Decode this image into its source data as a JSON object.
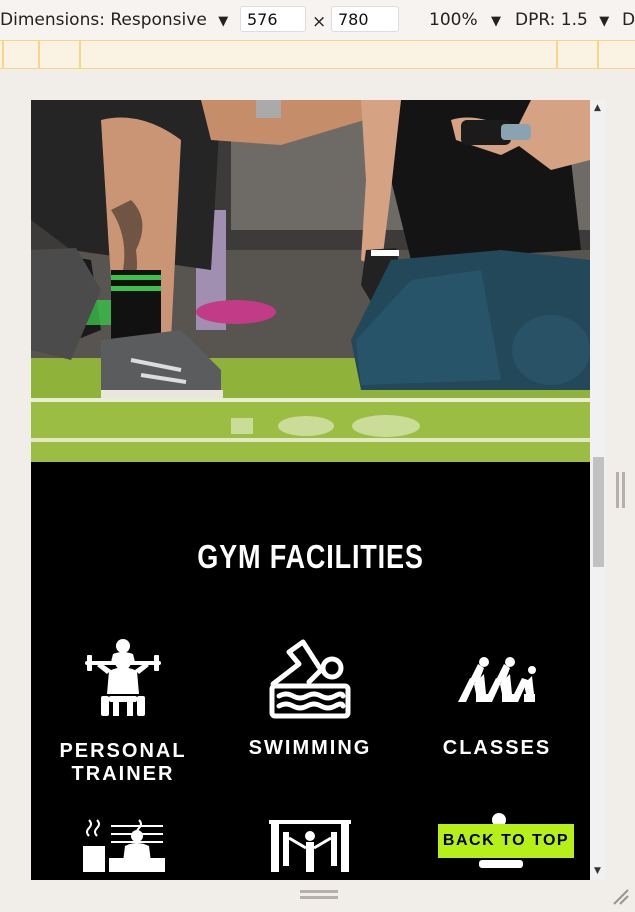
{
  "toolbar": {
    "dimensions_label": "Dimensions: Responsive",
    "width_value": "576",
    "times_symbol": "×",
    "height_value": "780",
    "zoom_label": "100%",
    "dpr_label": "DPR: 1.5",
    "overflow_label": "D"
  },
  "page": {
    "facilities_title": "GYM FACILITIES",
    "facilities": [
      {
        "line1": "PERSONAL",
        "line2": "TRAINER"
      },
      {
        "line1": "SWIMMING",
        "line2": ""
      },
      {
        "line1": "CLASSES",
        "line2": ""
      }
    ],
    "back_to_top": "BACK TO TOP",
    "accent_color": "#b7f019"
  }
}
